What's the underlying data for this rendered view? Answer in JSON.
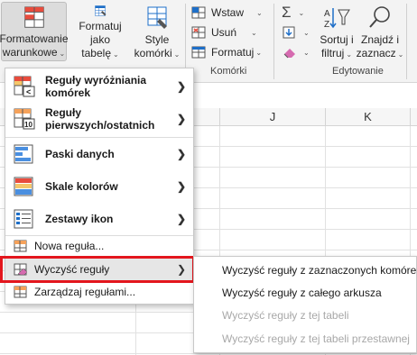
{
  "ribbon": {
    "conditional_formatting": {
      "line1": "Formatowanie",
      "line2": "warunkowe"
    },
    "format_as_table": {
      "line1": "Formatuj jako",
      "line2": "tabelę"
    },
    "cell_styles": {
      "line1": "Style",
      "line2": "komórki"
    },
    "insert": "Wstaw",
    "delete": "Usuń",
    "format": "Formatuj",
    "cells_group": "Komórki",
    "sort_filter": {
      "line1": "Sortuj i",
      "line2": "filtruj"
    },
    "find_select": {
      "line1": "Znajdź i",
      "line2": "zaznacz"
    },
    "editing_group": "Edytowanie",
    "autosum_icon": "sigma-icon",
    "fill_icon": "fill-down-icon",
    "clear_icon": "eraser-icon"
  },
  "sheet": {
    "columns": [
      "J",
      "K"
    ]
  },
  "menu": {
    "items": [
      {
        "label": "Reguły wyróżniania komórek",
        "icon": "highlight-rules-icon"
      },
      {
        "label": "Reguły pierwszych/ostatnich",
        "icon": "top-bottom-rules-icon"
      },
      {
        "label": "Paski danych",
        "icon": "data-bars-icon"
      },
      {
        "label": "Skale kolorów",
        "icon": "color-scales-icon"
      },
      {
        "label": "Zestawy ikon",
        "icon": "icon-sets-icon"
      },
      {
        "label": "Nowa reguła...",
        "icon": "new-rule-icon"
      },
      {
        "label": "Wyczyść reguły",
        "icon": "clear-rules-icon"
      },
      {
        "label": "Zarządzaj regułami...",
        "icon": "manage-rules-icon"
      }
    ]
  },
  "submenu": {
    "items": [
      {
        "label": "Wyczyść reguły z zaznaczonych komórek",
        "enabled": true
      },
      {
        "label": "Wyczyść reguły z całego arkusza",
        "enabled": true
      },
      {
        "label": "Wyczyść reguły z tej tabeli",
        "enabled": false
      },
      {
        "label": "Wyczyść reguły z tej tabeli przestawnej",
        "enabled": false
      }
    ]
  },
  "colors": {
    "highlight_border": "#e3161d",
    "accent_blue": "#1e6fc8",
    "accent_red": "#e84c3d"
  }
}
